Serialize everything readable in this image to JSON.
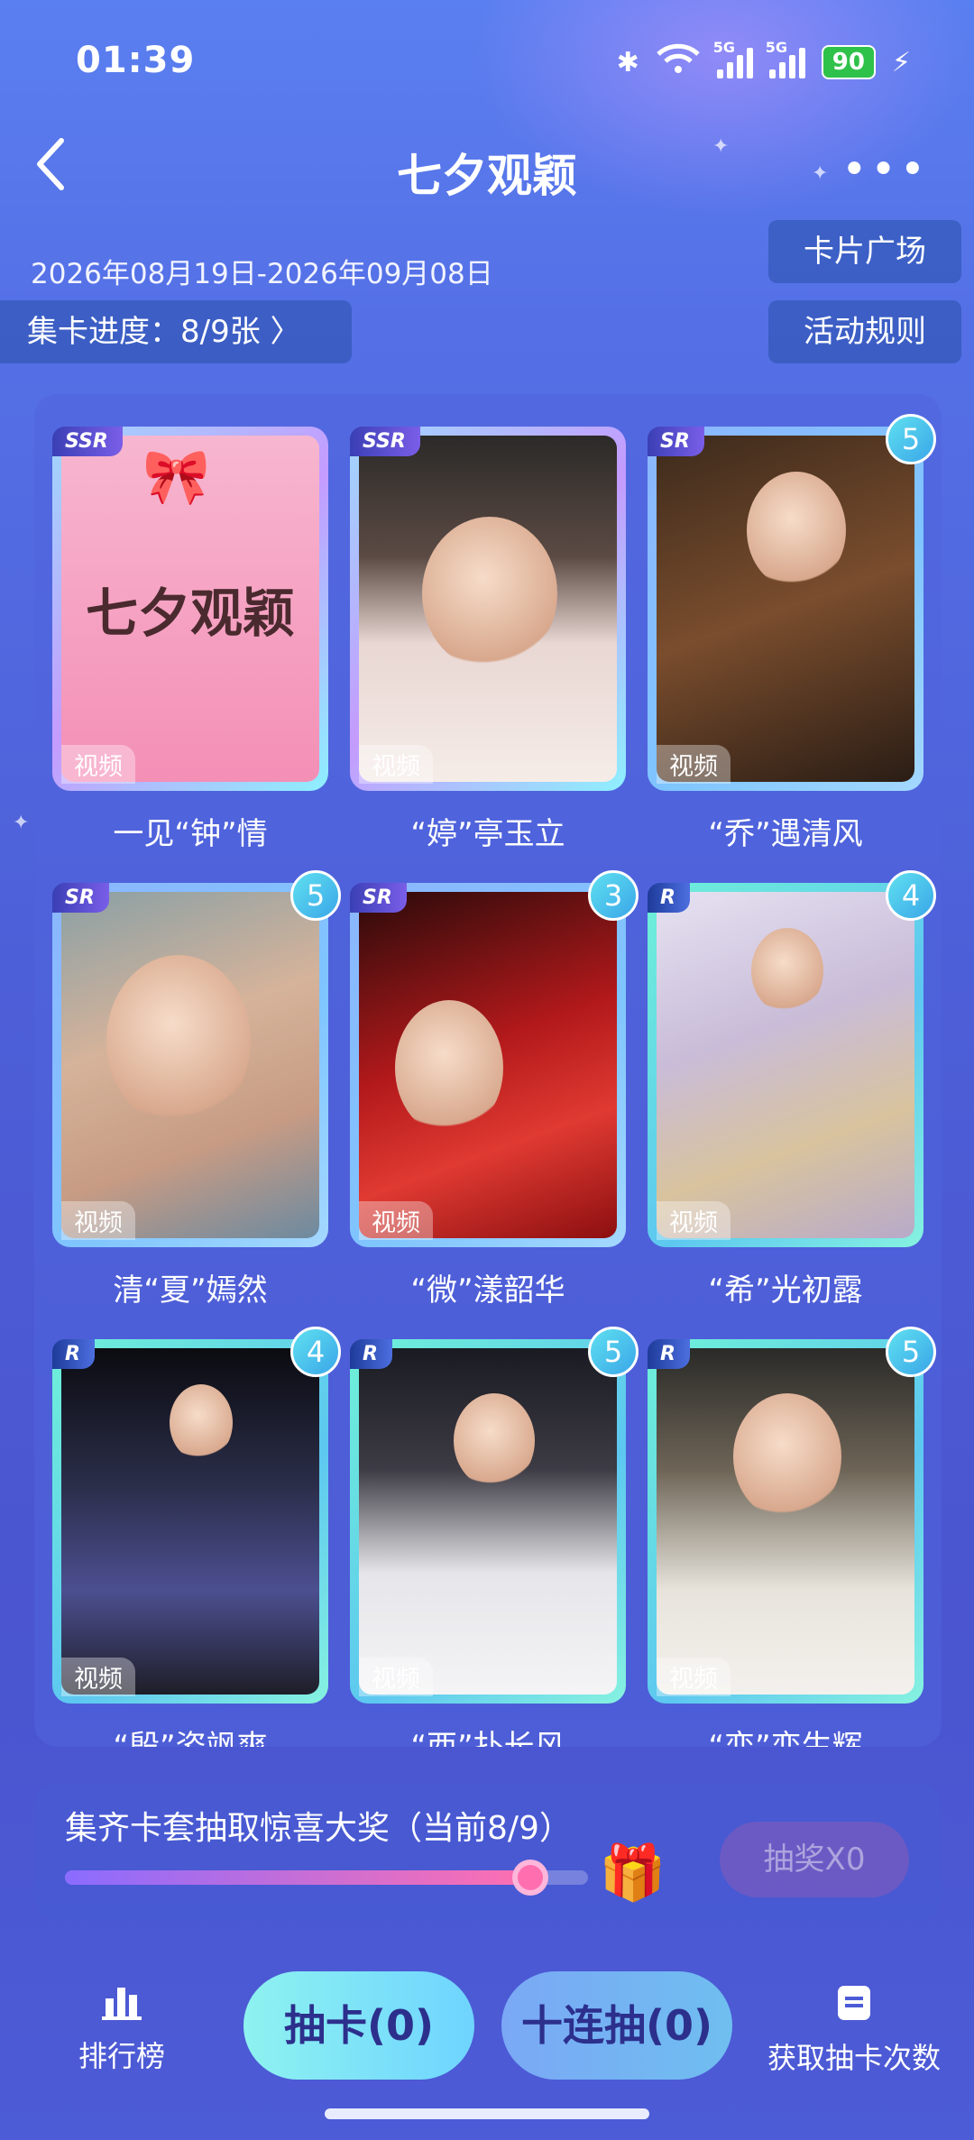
{
  "status_bar": {
    "time": "01:39",
    "battery": "90",
    "network": "5G"
  },
  "header": {
    "title": "七夕观颖",
    "back_icon": "chevron-left-icon",
    "more_icon": "more-dots-icon"
  },
  "event": {
    "date_range": "2026年08月19日-2026年09月08日",
    "collect_progress": "集卡进度：8/9张 〉",
    "card_plaza": "卡片广场",
    "rules": "活动规则"
  },
  "cards": [
    {
      "rank": "SSR",
      "name": "一见“钟”情",
      "tag": "视频",
      "count": "",
      "cover_text": "七夕观颖"
    },
    {
      "rank": "SSR",
      "name": "“婷”亭玉立",
      "tag": "视频",
      "count": ""
    },
    {
      "rank": "SR",
      "name": "“乔”遇清风",
      "tag": "视频",
      "count": "5"
    },
    {
      "rank": "SR",
      "name": "清“夏”嫣然",
      "tag": "视频",
      "count": "5"
    },
    {
      "rank": "SR",
      "name": "“微”漾韶华",
      "tag": "视频",
      "count": "3"
    },
    {
      "rank": "R",
      "name": "“希”光初露",
      "tag": "视频",
      "count": "4"
    },
    {
      "rank": "R",
      "name": "“殷”姿飒爽",
      "tag": "视频",
      "count": "4"
    },
    {
      "rank": "R",
      "name": "“西”扑长风",
      "tag": "视频",
      "count": "5"
    },
    {
      "rank": "R",
      "name": "“恋”恋生辉",
      "tag": "视频",
      "count": "5"
    }
  ],
  "prize": {
    "text": "集齐卡套抽取惊喜大奖（当前8/9）",
    "progress": 0.889,
    "draw_button": "抽奖X0",
    "gift_icon": "gift-icon"
  },
  "bottom_nav": {
    "ranking": "排行榜",
    "draw": "抽卡(0)",
    "draw_ten": "十连抽(0)",
    "get_chances": "获取抽卡次数"
  }
}
